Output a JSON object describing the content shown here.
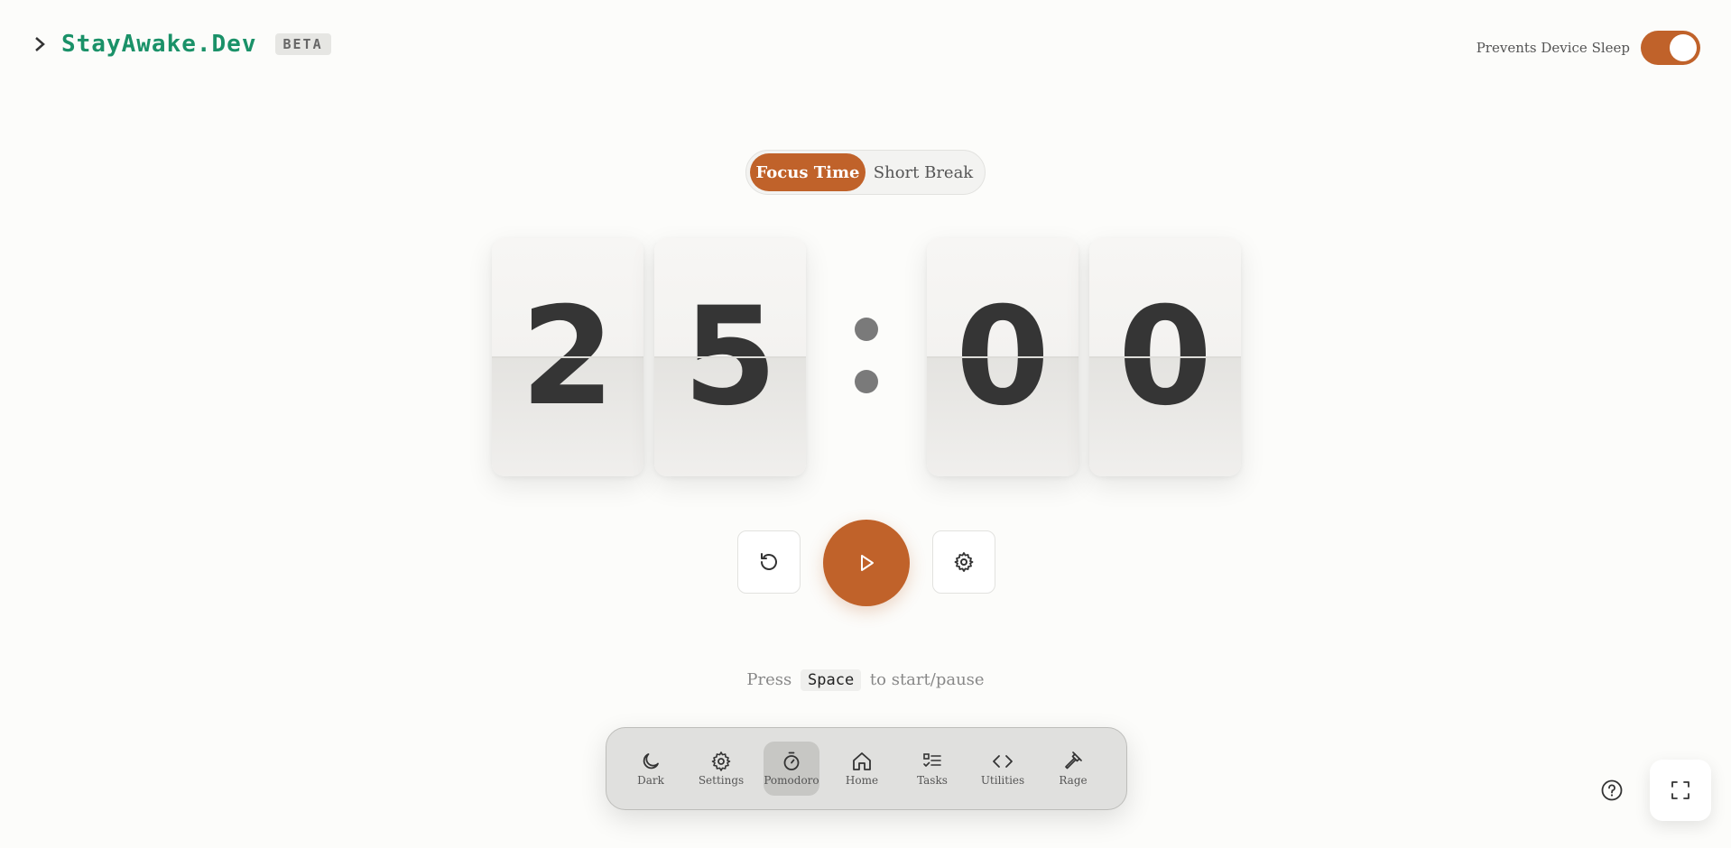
{
  "header": {
    "app_name": "StayAwake.Dev",
    "badge": "BETA",
    "sleep_label": "Prevents Device Sleep",
    "sleep_enabled": true
  },
  "modes": [
    {
      "label": "Focus Time",
      "active": true
    },
    {
      "label": "Short Break",
      "active": false
    }
  ],
  "timer": {
    "digits": [
      "2",
      "5",
      "0",
      "0"
    ],
    "separator": ":"
  },
  "controls": {
    "reset_icon": "reset-icon",
    "play_icon": "play-icon",
    "settings_icon": "gear-icon"
  },
  "hint": {
    "before": "Press",
    "key": "Space",
    "after": "to start/pause"
  },
  "dock": [
    {
      "label": "Dark",
      "icon": "moon-icon"
    },
    {
      "label": "Settings",
      "icon": "gear-icon"
    },
    {
      "label": "Pomodoro",
      "icon": "stopwatch-icon",
      "active": true
    },
    {
      "label": "Home",
      "icon": "home-icon"
    },
    {
      "label": "Tasks",
      "icon": "checklist-icon"
    },
    {
      "label": "Utilities",
      "icon": "code-icon"
    },
    {
      "label": "Rage",
      "icon": "hammer-icon"
    }
  ],
  "colors": {
    "accent": "#c0622a",
    "brand": "#1a9168",
    "background": "#fcfcfa"
  }
}
